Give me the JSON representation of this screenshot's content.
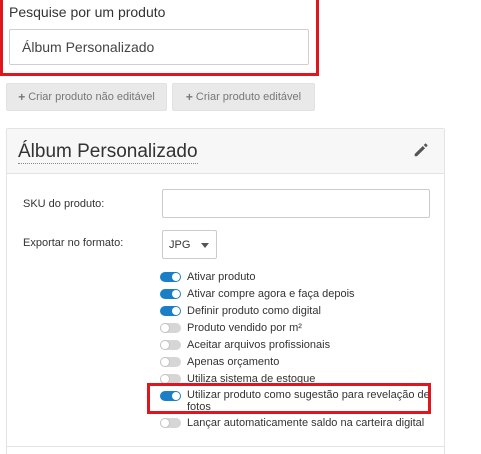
{
  "search": {
    "label": "Pesquise por um produto",
    "value": "Álbum Personalizado"
  },
  "actions": {
    "create_not_editable": "Criar produto não editável",
    "create_editable": "Criar produto editável"
  },
  "product": {
    "title": "Álbum Personalizado",
    "sku_label": "SKU do produto:",
    "sku_value": "",
    "export_label": "Exportar no formato:",
    "export_value": "JPG"
  },
  "options": [
    {
      "label": "Ativar produto",
      "enabled": true
    },
    {
      "label": "Ativar compre agora e faça depois",
      "enabled": true
    },
    {
      "label": "Definir produto como digital",
      "enabled": true
    },
    {
      "label": "Produto vendido por m²",
      "enabled": false
    },
    {
      "label": "Aceitar arquivos profissionais",
      "enabled": false
    },
    {
      "label": "Apenas orçamento",
      "enabled": false
    },
    {
      "label": "Utiliza sistema de estoque",
      "enabled": false
    },
    {
      "label": "Utilizar produto como sugestão para revelação de",
      "label_line2": "fotos",
      "enabled": true
    },
    {
      "label": "Lançar automaticamente saldo na carteira digital",
      "enabled": false
    }
  ],
  "colors": {
    "accent": "#1a7fc6",
    "highlight": "#e0161e"
  }
}
